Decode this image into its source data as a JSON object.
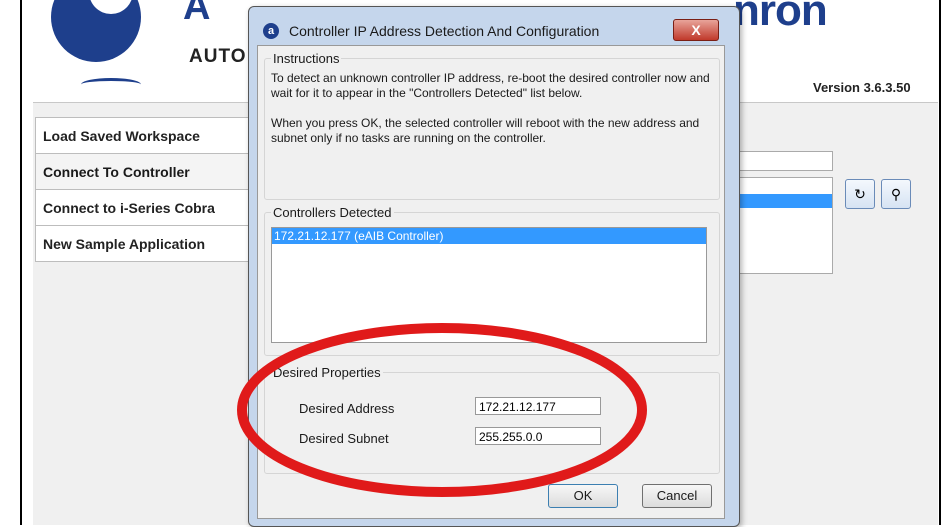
{
  "header": {
    "brand_left": "A",
    "brand_sub": "AUTO",
    "brand_right": "nron",
    "version": "Version 3.6.3.50"
  },
  "sidebar": {
    "items": [
      {
        "label": "Load Saved Workspace"
      },
      {
        "label": "Connect To Controller"
      },
      {
        "label": "Connect to i-Series Cobra"
      },
      {
        "label": "New Sample Application"
      }
    ]
  },
  "dialog": {
    "title": "Controller IP Address Detection And Configuration",
    "close_label": "X",
    "instructions": {
      "title": "Instructions",
      "line1": "To detect an unknown controller IP address, re-boot the desired controller now and wait for it to appear in the \"Controllers Detected\" list below.",
      "line2": "When you press OK, the selected controller will reboot with the new address and subnet only if no tasks are running on the controller."
    },
    "detected": {
      "title": "Controllers Detected",
      "items": [
        "172.21.12.177 (eAIB Controller)"
      ]
    },
    "properties": {
      "title": "Desired Properties",
      "address_label": "Desired Address",
      "address_value": "172.21.12.177",
      "subnet_label": "Desired Subnet",
      "subnet_value": "255.255.0.0"
    },
    "ok_label": "OK",
    "cancel_label": "Cancel"
  },
  "colors": {
    "brand_blue": "#1e3f8c",
    "selection": "#3399ff",
    "highlight_ring": "#e01a1a"
  }
}
